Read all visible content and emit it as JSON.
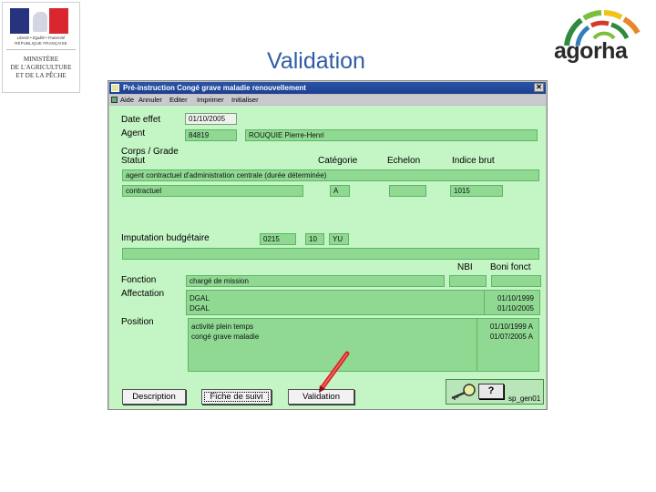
{
  "slide": {
    "title": "Validation",
    "ministry": {
      "motto": "Liberté • Égalité • Fraternité",
      "republic": "RÉPUBLIQUE FRANÇAISE",
      "name_lines": [
        "MINISTÈRE",
        "DE L'AGRICULTURE",
        "ET DE LA PÊCHE"
      ]
    },
    "brand": "agorha",
    "brand_colors": [
      "#2e8b3d",
      "#7cbf3a",
      "#f0c419",
      "#e8872a",
      "#d23a2a",
      "#2f7fb8"
    ]
  },
  "window": {
    "title": "Pré-instruction Congé grave maladie renouvellement",
    "close_glyph": "✕",
    "menu": [
      "Aide",
      "Annuler",
      "Editer",
      "Imprimer",
      "Initialiser"
    ],
    "title_color": "#2a54a8",
    "form_color": "#c4f5c4",
    "field_color": "#8fd992"
  },
  "form": {
    "date_effet": {
      "label": "Date effet",
      "value": "01/10/2005"
    },
    "agent": {
      "label": "Agent",
      "id": "84819",
      "name": "ROUQUIE Pierre-Henri"
    },
    "corps_grade_label": "Corps / Grade",
    "statut_label": "Statut",
    "categorie_label": "Catégorie",
    "echelon_label": "Echelon",
    "indice_label": "Indice brut",
    "statut_value": "agent contractuel d'administration centrale (durée déterminée)",
    "contract_value": "contractuel",
    "categorie_value": "A",
    "echelon_value": "",
    "indice_value": "1015",
    "imputation": {
      "label": "Imputation budgétaire",
      "codes": [
        "0215",
        "10",
        "YU"
      ]
    },
    "nbi_label": "NBI",
    "boni_label": "Boni fonct",
    "fonction": {
      "label": "Fonction",
      "value": "chargé de mission"
    },
    "affectation": {
      "label": "Affectation",
      "rows": [
        {
          "name": "DGAL",
          "date": "01/10/1999"
        },
        {
          "name": "DGAL",
          "date": "01/10/2005"
        }
      ]
    },
    "position": {
      "label": "Position",
      "rows": [
        {
          "name": "activité plein temps",
          "date": "01/10/1999",
          "flag": "A"
        },
        {
          "name": "congé grave maladie",
          "date": "01/07/2005",
          "flag": "A"
        }
      ]
    }
  },
  "buttons": {
    "description": "Description",
    "fiche": "Fiche de suivi",
    "validation": "Validation",
    "help": "?",
    "screen_code": "sp_gen01"
  }
}
